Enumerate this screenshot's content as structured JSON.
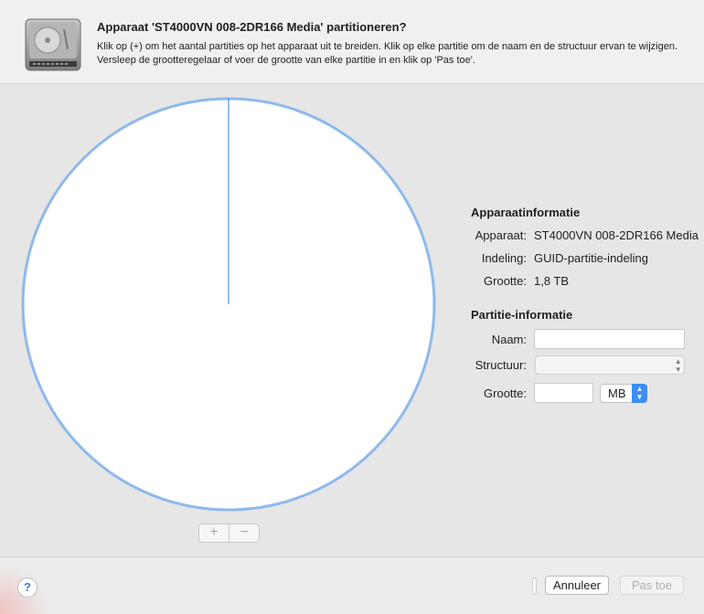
{
  "header": {
    "icon": "hard-drive-icon",
    "title": "Apparaat 'ST4000VN 008-2DR166 Media' partitioneren?",
    "description": "Klik op (+) om het aantal partities op het apparaat uit te breiden. Klik op elke partitie om de naam en de structuur ervan te wijzigen. Versleep de grootteregelaar of voer de grootte van elke partitie in en klik op 'Pas toe'."
  },
  "pie": {
    "fill_color": "#ffffff",
    "border_color": "#8fb9ec",
    "divider_color": "#2f78d2",
    "add_label": "+",
    "remove_label": "−"
  },
  "device_info": {
    "heading": "Apparaatinformatie",
    "rows": [
      {
        "label": "Apparaat:",
        "value": "ST4000VN 008-2DR166 Media"
      },
      {
        "label": "Indeling:",
        "value": "GUID-partitie-indeling"
      },
      {
        "label": "Grootte:",
        "value": "1,8 TB"
      }
    ]
  },
  "partition_info": {
    "heading": "Partitie-informatie",
    "name_label": "Naam:",
    "name_value": "",
    "format_label": "Structuur:",
    "format_value": "",
    "size_label": "Grootte:",
    "size_value": "",
    "unit_value": "MB"
  },
  "footer": {
    "help_label": "?",
    "cancel_label": "Annuleer",
    "apply_label": "Pas toe"
  }
}
